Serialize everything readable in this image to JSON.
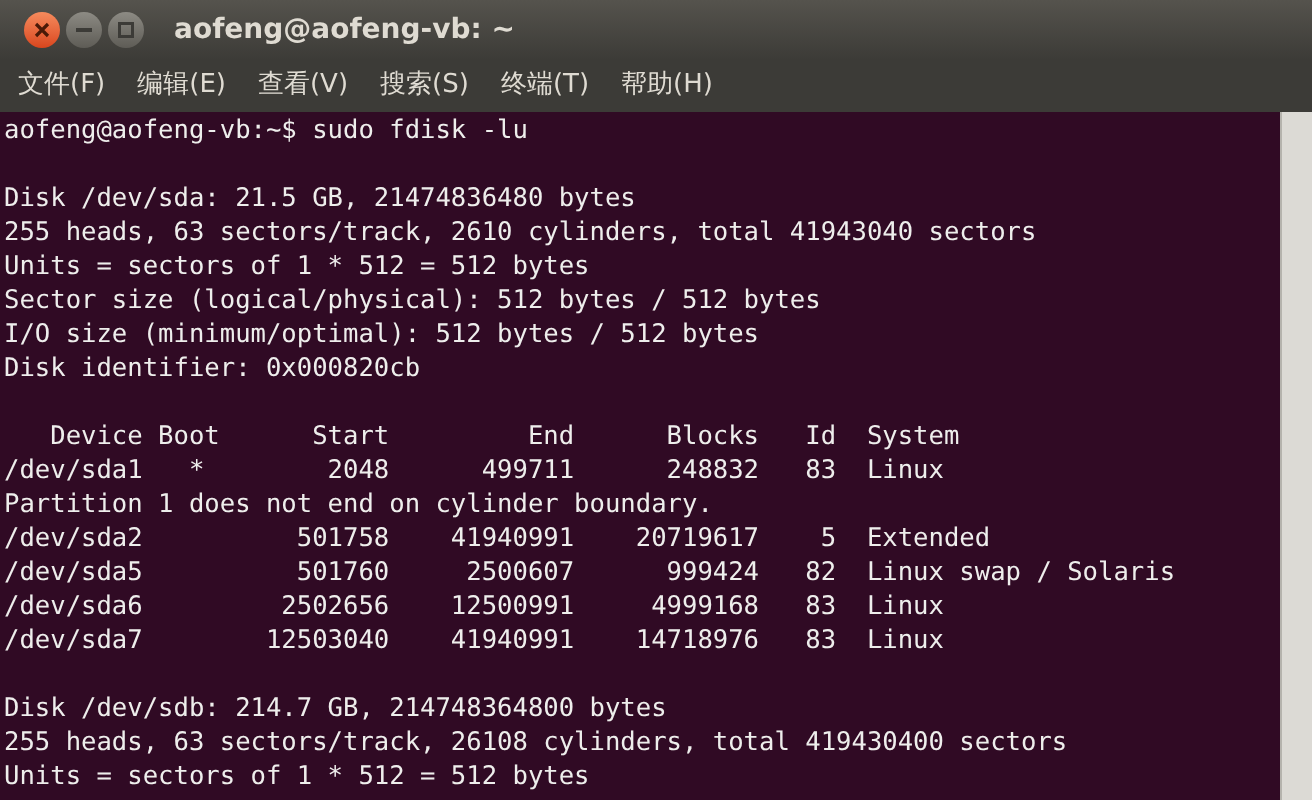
{
  "window": {
    "title": "aofeng@aofeng-vb: ~"
  },
  "menu": [
    "文件(F)",
    "编辑(E)",
    "查看(V)",
    "搜索(S)",
    "终端(T)",
    "帮助(H)"
  ],
  "terminal": {
    "blocks": [
      [
        "aofeng@aofeng-vb:~$ sudo fdisk -lu"
      ],
      [
        "Disk /dev/sda: 21.5 GB, 21474836480 bytes",
        "255 heads, 63 sectors/track, 2610 cylinders, total 41943040 sectors",
        "Units = sectors of 1 * 512 = 512 bytes",
        "Sector size (logical/physical): 512 bytes / 512 bytes",
        "I/O size (minimum/optimal): 512 bytes / 512 bytes",
        "Disk identifier: 0x000820cb"
      ],
      [
        "   Device Boot      Start         End      Blocks   Id  System",
        "/dev/sda1   *        2048      499711      248832   83  Linux",
        "Partition 1 does not end on cylinder boundary.",
        "/dev/sda2          501758    41940991    20719617    5  Extended",
        "/dev/sda5          501760     2500607      999424   82  Linux swap / Solaris",
        "/dev/sda6         2502656    12500991     4999168   83  Linux",
        "/dev/sda7        12503040    41940991    14718976   83  Linux"
      ],
      [
        "Disk /dev/sdb: 214.7 GB, 214748364800 bytes",
        "255 heads, 63 sectors/track, 26108 cylinders, total 419430400 sectors",
        "Units = sectors of 1 * 512 = 512 bytes"
      ]
    ]
  }
}
